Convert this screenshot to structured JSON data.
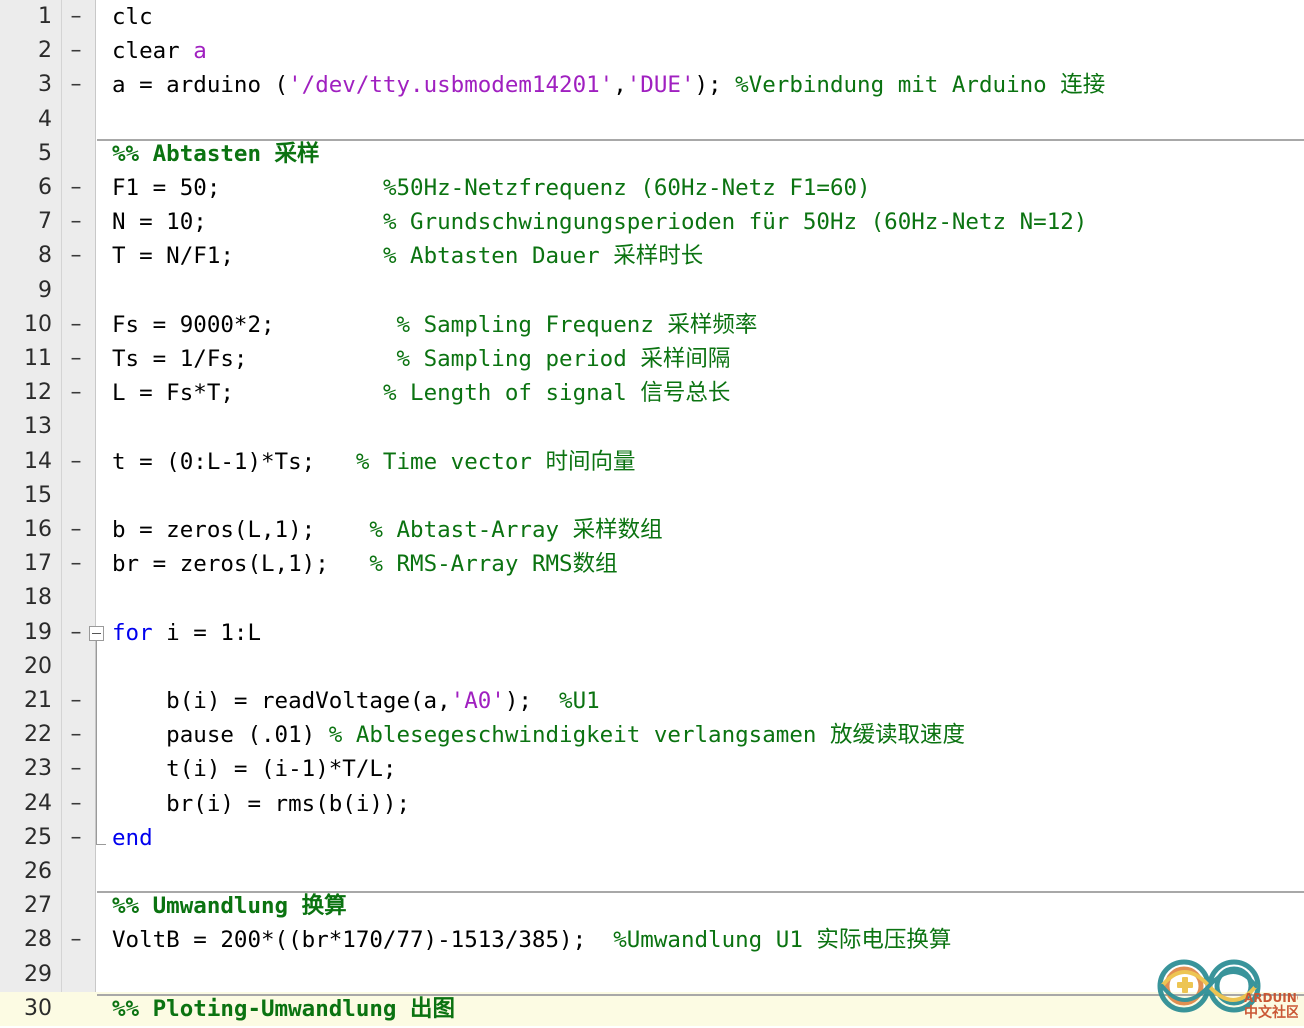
{
  "editor": {
    "language": "MATLAB",
    "colors": {
      "background": "#ffffff",
      "gutter_background": "#ececec",
      "comment": "#0b7311",
      "string": "#a020c0",
      "keyword": "#0000ee",
      "section_highlight": "#fcfbe3",
      "fold_line": "#9a9a9a"
    },
    "total_lines": 30
  },
  "watermark": {
    "brand": "ARDUINO",
    "subtitle": "中文社区",
    "teal": "#2f8f96",
    "orange": "#e08a4a",
    "yellow": "#edc24a",
    "red": "#c8502d"
  },
  "lines": [
    {
      "n": "1",
      "dash": "–",
      "tokens": [
        {
          "t": "clc",
          "c": "plain"
        }
      ]
    },
    {
      "n": "2",
      "dash": "–",
      "tokens": [
        {
          "t": "clear ",
          "c": "plain"
        },
        {
          "t": "a",
          "c": "string"
        }
      ]
    },
    {
      "n": "3",
      "dash": "–",
      "tokens": [
        {
          "t": "a = arduino (",
          "c": "plain"
        },
        {
          "t": "'/dev/tty.usbmodem14201'",
          "c": "string"
        },
        {
          "t": ",",
          "c": "plain"
        },
        {
          "t": "'DUE'",
          "c": "string"
        },
        {
          "t": "); ",
          "c": "plain"
        },
        {
          "t": "%Verbindung mit Arduino 连接",
          "c": "comment"
        }
      ]
    },
    {
      "n": "4",
      "dash": "",
      "tokens": []
    },
    {
      "n": "5",
      "dash": "",
      "divider": true,
      "tokens": [
        {
          "t": "%% Abtasten 采样",
          "c": "section"
        }
      ]
    },
    {
      "n": "6",
      "dash": "–",
      "tokens": [
        {
          "t": "F1 = 50;            ",
          "c": "plain"
        },
        {
          "t": "%50Hz-Netzfrequenz (60Hz-Netz F1=60)",
          "c": "comment"
        }
      ]
    },
    {
      "n": "7",
      "dash": "–",
      "tokens": [
        {
          "t": "N = 10;             ",
          "c": "plain"
        },
        {
          "t": "% Grundschwingungsperioden für 50Hz (60Hz-Netz N=12)",
          "c": "comment"
        }
      ]
    },
    {
      "n": "8",
      "dash": "–",
      "tokens": [
        {
          "t": "T = N/F1;           ",
          "c": "plain"
        },
        {
          "t": "% Abtasten Dauer 采样时长",
          "c": "comment"
        }
      ]
    },
    {
      "n": "9",
      "dash": "",
      "tokens": []
    },
    {
      "n": "10",
      "dash": "–",
      "tokens": [
        {
          "t": "Fs = 9000*2;         ",
          "c": "plain"
        },
        {
          "t": "% Sampling Frequenz 采样频率",
          "c": "comment"
        }
      ]
    },
    {
      "n": "11",
      "dash": "–",
      "tokens": [
        {
          "t": "Ts = 1/Fs;           ",
          "c": "plain"
        },
        {
          "t": "% Sampling period 采样间隔",
          "c": "comment"
        }
      ]
    },
    {
      "n": "12",
      "dash": "–",
      "tokens": [
        {
          "t": "L = Fs*T;           ",
          "c": "plain"
        },
        {
          "t": "% Length of signal 信号总长",
          "c": "comment"
        }
      ]
    },
    {
      "n": "13",
      "dash": "",
      "tokens": []
    },
    {
      "n": "14",
      "dash": "–",
      "tokens": [
        {
          "t": "t = (0:L-1)*Ts;   ",
          "c": "plain"
        },
        {
          "t": "% Time vector 时间向量",
          "c": "comment"
        }
      ]
    },
    {
      "n": "15",
      "dash": "",
      "tokens": []
    },
    {
      "n": "16",
      "dash": "–",
      "tokens": [
        {
          "t": "b = zeros(L,1);    ",
          "c": "plain"
        },
        {
          "t": "% Abtast-Array 采样数组",
          "c": "comment"
        }
      ]
    },
    {
      "n": "17",
      "dash": "–",
      "tokens": [
        {
          "t": "br = zeros(L,1);   ",
          "c": "plain"
        },
        {
          "t": "% RMS-Array RMS数组",
          "c": "comment"
        }
      ]
    },
    {
      "n": "18",
      "dash": "",
      "tokens": []
    },
    {
      "n": "19",
      "dash": "–",
      "fold": "open",
      "tokens": [
        {
          "t": "for",
          "c": "keyword"
        },
        {
          "t": " i = 1:L",
          "c": "plain"
        }
      ]
    },
    {
      "n": "20",
      "dash": "",
      "tokens": []
    },
    {
      "n": "21",
      "dash": "–",
      "tokens": [
        {
          "t": "    b(i) = readVoltage(a,",
          "c": "plain"
        },
        {
          "t": "'A0'",
          "c": "string"
        },
        {
          "t": ");  ",
          "c": "plain"
        },
        {
          "t": "%U1",
          "c": "comment"
        }
      ]
    },
    {
      "n": "22",
      "dash": "–",
      "tokens": [
        {
          "t": "    pause (.01) ",
          "c": "plain"
        },
        {
          "t": "% Ablesegeschwindigkeit verlangsamen 放缓读取速度",
          "c": "comment"
        }
      ]
    },
    {
      "n": "23",
      "dash": "–",
      "tokens": [
        {
          "t": "    t(i) = (i-1)*T/L;",
          "c": "plain"
        }
      ]
    },
    {
      "n": "24",
      "dash": "–",
      "tokens": [
        {
          "t": "    br(i) = rms(b(i));",
          "c": "plain"
        }
      ]
    },
    {
      "n": "25",
      "dash": "–",
      "foldend": true,
      "tokens": [
        {
          "t": "end",
          "c": "keyword"
        }
      ]
    },
    {
      "n": "26",
      "dash": "",
      "tokens": []
    },
    {
      "n": "27",
      "dash": "",
      "divider": true,
      "tokens": [
        {
          "t": "%% Umwandlung 换算",
          "c": "section"
        }
      ]
    },
    {
      "n": "28",
      "dash": "–",
      "tokens": [
        {
          "t": "VoltB = 200*((br*170/77)-1513/385);  ",
          "c": "plain"
        },
        {
          "t": "%Umwandlung U1 实际电压换算",
          "c": "comment"
        }
      ]
    },
    {
      "n": "29",
      "dash": "",
      "tokens": []
    },
    {
      "n": "30",
      "dash": "",
      "divider": true,
      "active": true,
      "tokens": [
        {
          "t": "%% Ploting-Umwandlung 出图",
          "c": "section"
        }
      ]
    }
  ]
}
